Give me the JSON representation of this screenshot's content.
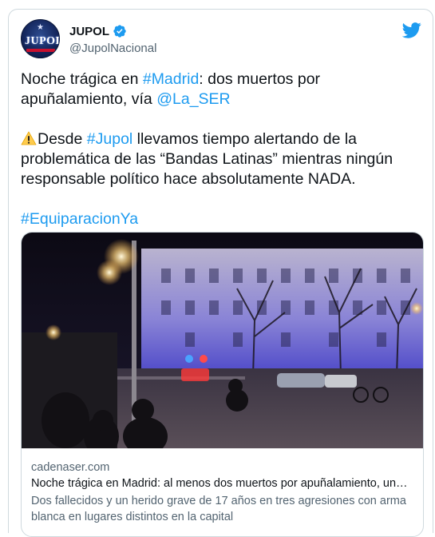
{
  "author": {
    "name": "JUPOL",
    "handle": "@JupolNacional",
    "verified": true,
    "avatar_text": "JUPOL",
    "avatar_icon": "police-badge-logo"
  },
  "tweet": {
    "line1_pre": "Noche trágica en ",
    "line1_hashtag": "#Madrid",
    "line1_post": ": dos muertos por apuñalamiento, vía ",
    "line1_mention": "@La_SER",
    "line2_emoji": "warning-icon",
    "line2_pre": "Desde ",
    "line2_hashtag": "#Jupol",
    "line2_post": " llevamos tiempo alertando de la problemática de las “Bandas Latinas” mientras ningún responsable político hace absolutamente NADA.",
    "line3_hashtag": "#EquiparacionYa"
  },
  "card": {
    "domain": "cadenaser.com",
    "title": "Noche trágica en Madrid: al menos dos muertos por apuñalamiento, un…",
    "description": "Dos fallecidos y un herido grave de 17 años en tres agresiones con arma blanca en lugares distintos en la capital",
    "image": "night-street-madrid-police-lights"
  },
  "colors": {
    "link": "#1d9bf0",
    "text": "#0f1419",
    "secondary": "#536471",
    "border": "#cfd9de"
  },
  "icons": {
    "brand": "twitter-bird-icon",
    "verified": "verified-badge-icon"
  }
}
